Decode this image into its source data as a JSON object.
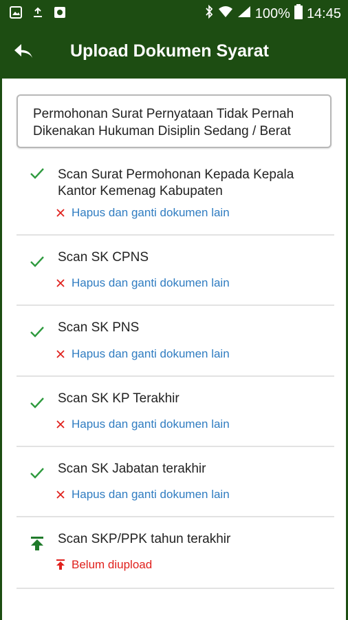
{
  "status_bar": {
    "battery": "100%",
    "time": "14:45",
    "icons": [
      "image-icon",
      "download-icon",
      "store-icon",
      "bluetooth-icon",
      "wifi-icon",
      "signal-icon",
      "battery-icon"
    ]
  },
  "app_bar": {
    "title": "Upload Dokumen Syarat",
    "back_icon": "back-arrow-icon"
  },
  "header": {
    "title": "Permohonan Surat Pernyataan Tidak Pernah Dikenakan Hukuman Disiplin Sedang / Berat"
  },
  "documents": [
    {
      "label": "Scan Surat Permohonan Kepada Kepala Kantor Kemenag Kabupaten",
      "status": "uploaded",
      "action": "Hapus dan ganti dokumen lain"
    },
    {
      "label": "Scan SK CPNS",
      "status": "uploaded",
      "action": "Hapus dan ganti dokumen lain"
    },
    {
      "label": "Scan SK PNS",
      "status": "uploaded",
      "action": "Hapus dan ganti dokumen lain"
    },
    {
      "label": "Scan SK KP Terakhir",
      "status": "uploaded",
      "action": "Hapus dan ganti dokumen lain"
    },
    {
      "label": "Scan SK Jabatan  terakhir",
      "status": "uploaded",
      "action": "Hapus dan ganti dokumen lain"
    },
    {
      "label": "Scan SKP/PPK tahun terakhir",
      "status": "not_uploaded",
      "action": "Belum diupload"
    }
  ],
  "colors": {
    "primary": "#1d4d12",
    "check": "#2e9a3e",
    "link": "#2f7cc1",
    "error": "#e0201c"
  }
}
